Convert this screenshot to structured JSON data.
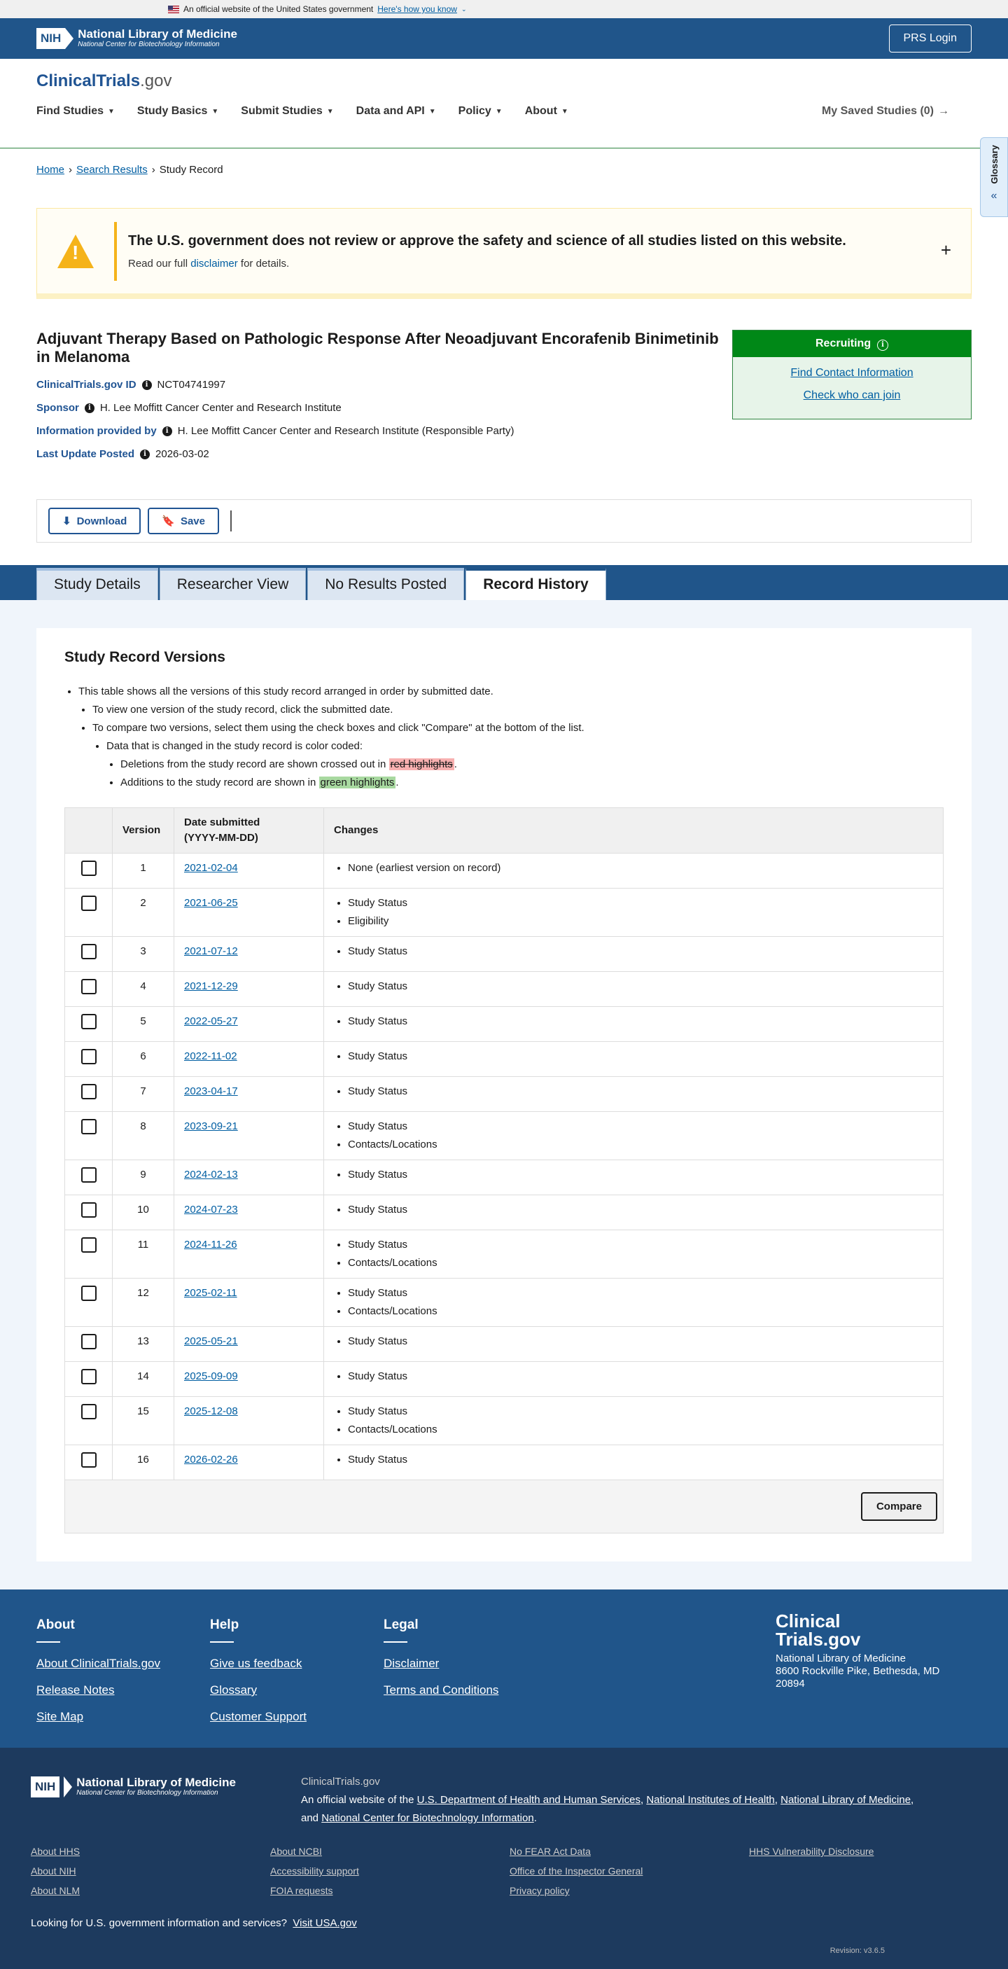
{
  "gov_banner": {
    "text": "An official website of the United States government",
    "link": "Here's how you know"
  },
  "nih": {
    "logo": "NIH",
    "title": "National Library of Medicine",
    "subtitle": "National Center for Biotechnology Information",
    "prs_login": "PRS Login"
  },
  "site": {
    "name_main": "ClinicalTrials",
    "name_suffix": ".gov"
  },
  "nav": {
    "items": [
      "Find Studies",
      "Study Basics",
      "Submit Studies",
      "Data and API",
      "Policy",
      "About"
    ],
    "saved": "My Saved Studies (0)"
  },
  "glossary": "Glossary",
  "breadcrumb": {
    "home": "Home",
    "results": "Search Results",
    "current": "Study Record"
  },
  "notice": {
    "title": "The U.S. government does not review or approve the safety and science of all studies listed on this website.",
    "pre": "Read our full",
    "link": "disclaimer",
    "post": "for details."
  },
  "study": {
    "title": "Adjuvant Therapy Based on Pathologic Response After Neoadjuvant Encorafenib Binimetinib in Melanoma",
    "id_label": "ClinicalTrials.gov ID",
    "id_value": "NCT04741997",
    "sponsor_label": "Sponsor",
    "sponsor_value": "H. Lee Moffitt Cancer Center and Research Institute",
    "provided_label": "Information provided by",
    "provided_value": "H. Lee Moffitt Cancer Center and Research Institute (Responsible Party)",
    "updated_label": "Last Update Posted",
    "updated_value": "2026-03-02"
  },
  "status": {
    "label": "Recruiting",
    "contact": "Find Contact Information",
    "join": "Check who can join",
    "color": "#008817"
  },
  "toolbar": {
    "download": "Download",
    "save": "Save"
  },
  "tabs": [
    "Study Details",
    "Researcher View",
    "No Results Posted",
    "Record History"
  ],
  "history": {
    "title": "Study Record Versions",
    "b1": "This table shows all the versions of this study record arranged in order by submitted date.",
    "b2": "To view one version of the study record, click the submitted date.",
    "b3": "To compare two versions, select them using the check boxes and click \"Compare\" at the bottom of the list.",
    "b4": "Data that is changed in the study record is color coded:",
    "b5_pre": "Deletions from the study record are shown crossed out in",
    "b5_hl": "red highlights",
    "b5_post": ".",
    "b6_pre": "Additions to the study record are shown in",
    "b6_hl": "green highlights",
    "b6_post": ".",
    "col_version": "Version",
    "col_date": "Date submitted",
    "col_date2": "(YYYY-MM-DD)",
    "col_changes": "Changes",
    "compare": "Compare",
    "rows": [
      {
        "v": "1",
        "d": "2021-02-04",
        "c": [
          "None (earliest version on record)"
        ]
      },
      {
        "v": "2",
        "d": "2021-06-25",
        "c": [
          "Study Status",
          "Eligibility"
        ]
      },
      {
        "v": "3",
        "d": "2021-07-12",
        "c": [
          "Study Status"
        ]
      },
      {
        "v": "4",
        "d": "2021-12-29",
        "c": [
          "Study Status"
        ]
      },
      {
        "v": "5",
        "d": "2022-05-27",
        "c": [
          "Study Status"
        ]
      },
      {
        "v": "6",
        "d": "2022-11-02",
        "c": [
          "Study Status"
        ]
      },
      {
        "v": "7",
        "d": "2023-04-17",
        "c": [
          "Study Status"
        ]
      },
      {
        "v": "8",
        "d": "2023-09-21",
        "c": [
          "Study Status",
          "Contacts/Locations"
        ]
      },
      {
        "v": "9",
        "d": "2024-02-13",
        "c": [
          "Study Status"
        ]
      },
      {
        "v": "10",
        "d": "2024-07-23",
        "c": [
          "Study Status"
        ]
      },
      {
        "v": "11",
        "d": "2024-11-26",
        "c": [
          "Study Status",
          "Contacts/Locations"
        ]
      },
      {
        "v": "12",
        "d": "2025-02-11",
        "c": [
          "Study Status",
          "Contacts/Locations"
        ]
      },
      {
        "v": "13",
        "d": "2025-05-21",
        "c": [
          "Study Status"
        ]
      },
      {
        "v": "14",
        "d": "2025-09-09",
        "c": [
          "Study Status"
        ]
      },
      {
        "v": "15",
        "d": "2025-12-08",
        "c": [
          "Study Status",
          "Contacts/Locations"
        ]
      },
      {
        "v": "16",
        "d": "2026-02-26",
        "c": [
          "Study Status"
        ]
      }
    ]
  },
  "footer": {
    "about_title": "About",
    "about_links": [
      "About ClinicalTrials.gov",
      "Release Notes",
      "Site Map"
    ],
    "help_title": "Help",
    "help_links": [
      "Give us feedback",
      "Glossary",
      "Customer Support"
    ],
    "legal_title": "Legal",
    "legal_links": [
      "Disclaimer",
      "Terms and Conditions"
    ],
    "logo_l1": "Clinical",
    "logo_l2": "Trials.gov",
    "org": "National Library of Medicine",
    "addr": "8600 Rockville Pike, Bethesda, MD 20894"
  },
  "footer2": {
    "site": "ClinicalTrials.gov",
    "desc_pre": "An official website of the",
    "hhs": "U.S. Department of Health and Human Services",
    "nih": "National Institutes of Health",
    "nlm": "National Library of Medicine",
    "and": "and",
    "ncbi": "National Center for Biotechnology Information",
    "links": [
      "About HHS",
      "About NCBI",
      "No FEAR Act Data",
      "HHS Vulnerability Disclosure",
      "About NIH",
      "Accessibility support",
      "Office of the Inspector General",
      "",
      "About NLM",
      "FOIA requests",
      "Privacy policy",
      ""
    ],
    "usa_pre": "Looking for U.S. government information and services?",
    "usa_link": "Visit USA.gov",
    "revision": "Revision: v3.6.5"
  }
}
